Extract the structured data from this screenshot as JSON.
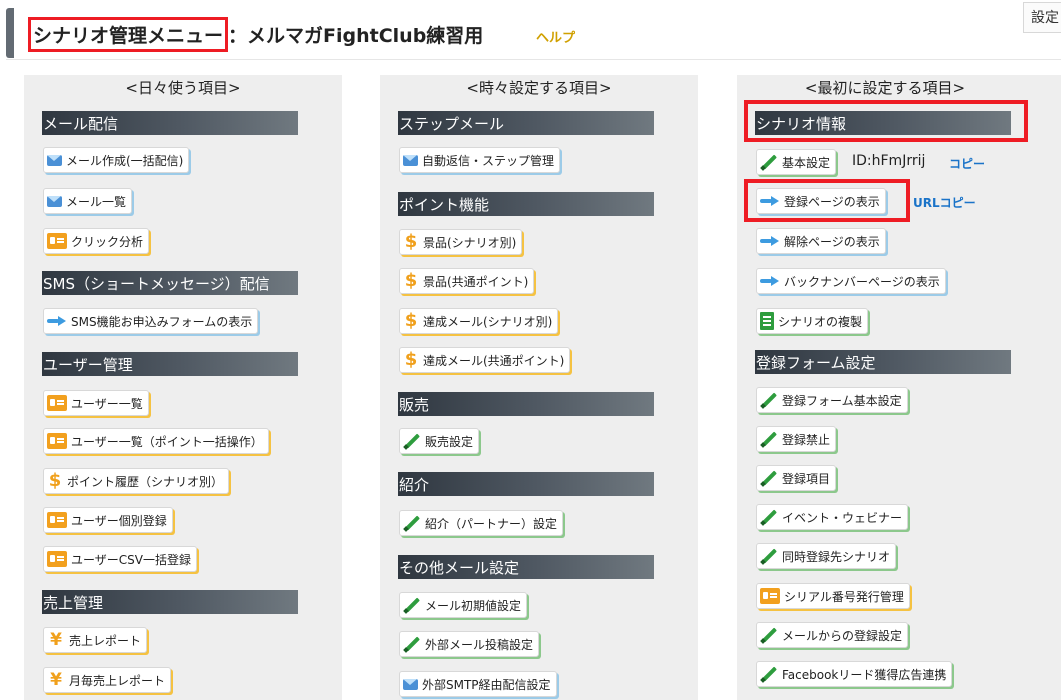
{
  "header": {
    "title_highlight": "シナリオ管理メニュー",
    "title_rest": "：メルマガFightClub練習用",
    "help_label": "ヘルプ",
    "settings_label": "設定"
  },
  "col1": {
    "heading": "<日々使う項目>",
    "sec_mail": "メール配信",
    "mail_create": "メール作成(一括配信)",
    "mail_list": "メール一覧",
    "click_analysis": "クリック分析",
    "sec_sms": "SMS（ショートメッセージ）配信",
    "sms_form": "SMS機能お申込みフォームの表示",
    "sec_user": "ユーザー管理",
    "user_list": "ユーザー一覧",
    "user_list_points": "ユーザー一覧（ポイント一括操作）",
    "point_history": "ポイント履歴（シナリオ別）",
    "user_register": "ユーザー個別登録",
    "user_csv": "ユーザーCSV一括登録",
    "sec_sales": "売上管理",
    "sales_report": "売上レポート",
    "monthly_report": "月毎売上レポート"
  },
  "col2": {
    "heading": "<時々設定する項目>",
    "sec_step": "ステップメール",
    "auto_reply": "自動返信・ステップ管理",
    "sec_point": "ポイント機能",
    "prize_scenario": "景品(シナリオ別)",
    "prize_common": "景品(共通ポイント)",
    "achieve_scenario": "達成メール(シナリオ別)",
    "achieve_common": "達成メール(共通ポイント)",
    "sec_sales": "販売",
    "sales_settings": "販売設定",
    "sec_intro": "紹介",
    "partner_settings": "紹介（パートナー）設定",
    "sec_other": "その他メール設定",
    "mail_initial": "メール初期値設定",
    "external_post": "外部メール投稿設定",
    "smtp_delivery": "外部SMTP経由配信設定"
  },
  "col3": {
    "heading": "<最初に設定する項目>",
    "sec_scenario": "シナリオ情報",
    "basic_settings": "基本設定",
    "scenario_id": "ID:hFmJrrij",
    "copy_label": "コピー",
    "show_register_page": "登録ページの表示",
    "url_copy_label": "URLコピー",
    "show_cancel_page": "解除ページの表示",
    "show_backnumber_page": "バックナンバーページの表示",
    "duplicate_scenario": "シナリオの複製",
    "sec_form": "登録フォーム設定",
    "form_basic": "登録フォーム基本設定",
    "register_ban": "登録禁止",
    "register_fields": "登録項目",
    "event_webinar": "イベント・ウェビナー",
    "simultaneous": "同時登録先シナリオ",
    "serial_number": "シリアル番号発行管理",
    "register_from_mail": "メールからの登録設定",
    "facebook_lead": "Facebookリード獲得広告連携"
  },
  "colors": {
    "highlight_red": "#ee1c24",
    "section_bar": "#3a424a",
    "help_gold": "#d0a000",
    "link_blue": "#1a73c8"
  }
}
